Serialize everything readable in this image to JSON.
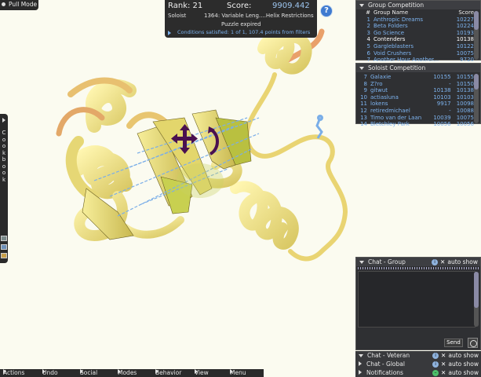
{
  "pull_mode": "Pull Mode",
  "score_panel": {
    "rank_label": "Rank: 21",
    "score_label": "Score:",
    "score_value": "9909.442",
    "mode": "Soloist",
    "puzzle_title": "1364: Variable Leng....Helix Restrictions",
    "status": "Puzzle expired",
    "conditions": "Conditions satisfied: 1 of 1, 107.4 points from filters",
    "help_icon": "?"
  },
  "cookbook": {
    "label": "Cookbook"
  },
  "group_competition": {
    "title": "Group Competition",
    "headers": [
      "#",
      "Group Name",
      "Score"
    ],
    "rows": [
      {
        "rank": "1",
        "name": "Anthropic Dreams",
        "score": "10227"
      },
      {
        "rank": "2",
        "name": "Beta Folders",
        "score": "10224"
      },
      {
        "rank": "3",
        "name": "Go Science",
        "score": "10193"
      },
      {
        "rank": "4",
        "name": "Contenders",
        "score": "10138"
      },
      {
        "rank": "5",
        "name": "Gargleblasters",
        "score": "10122"
      },
      {
        "rank": "6",
        "name": "Void Crushers",
        "score": "10075"
      },
      {
        "rank": "7",
        "name": "Another Hour Another...",
        "score": "9720"
      }
    ]
  },
  "soloist_competition": {
    "title": "Soloist Competition",
    "rows": [
      {
        "rank": "7",
        "name": "Galaxie",
        "score": "10155",
        "gscore": "10155"
      },
      {
        "rank": "8",
        "name": "Z?ro",
        "score": "-",
        "gscore": "10150"
      },
      {
        "rank": "9",
        "name": "gitwut",
        "score": "10138",
        "gscore": "10138"
      },
      {
        "rank": "10",
        "name": "actiasluna",
        "score": "10103",
        "gscore": "10103"
      },
      {
        "rank": "11",
        "name": "lokens",
        "score": "9917",
        "gscore": "10098"
      },
      {
        "rank": "12",
        "name": "retiredmichael",
        "score": "-",
        "gscore": "10088"
      },
      {
        "rank": "13",
        "name": "Timo van der Laan",
        "score": "10039",
        "gscore": "10075"
      },
      {
        "rank": "14",
        "name": "Bletchley Park",
        "score": "10056",
        "gscore": "10056"
      }
    ]
  },
  "chat_group": {
    "title": "Chat - Group",
    "auto_show": "auto show",
    "send": "Send"
  },
  "chat_tabs": [
    {
      "title": "Chat - Veteran",
      "auto_show": "auto show"
    },
    {
      "title": "Chat - Global",
      "auto_show": "auto show"
    },
    {
      "title": "Notifications",
      "auto_show": "auto show"
    }
  ],
  "bottom_menu": [
    "Actions",
    "Undo",
    "Social",
    "Modes",
    "Behavior",
    "View",
    "Menu"
  ],
  "colors": {
    "panel_bg": "#2f3033",
    "link_blue": "#7db3ef",
    "protein_yellow": "#f0e890",
    "protein_orange": "#e8a060",
    "hbond_blue": "#7aaee8",
    "tool_purple": "#5a1a5e"
  }
}
